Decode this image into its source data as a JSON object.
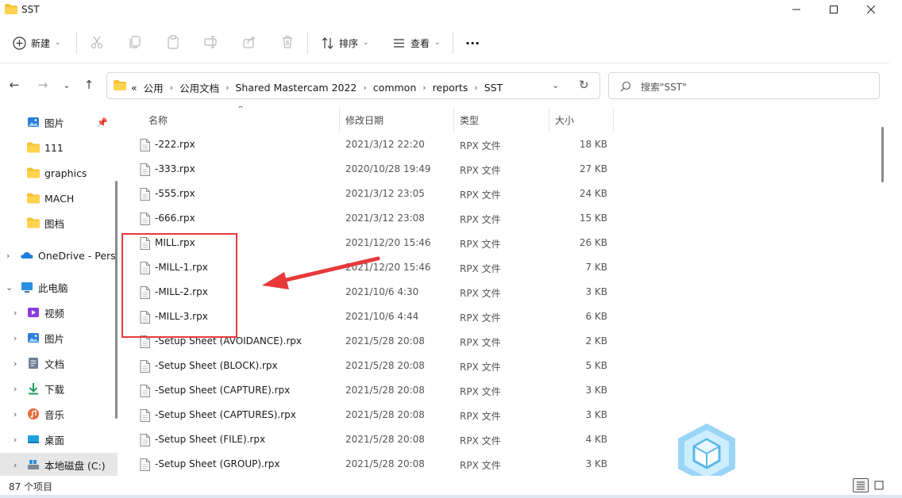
{
  "window": {
    "title": "SST",
    "minimize_icon": "minimize-icon",
    "maximize_icon": "maximize-icon",
    "close_icon": "close-icon"
  },
  "toolbar": {
    "new_label": "新建",
    "sort_label": "排序",
    "view_label": "查看",
    "more_label": "···",
    "icons": [
      "cut-icon",
      "copy-icon",
      "paste-icon",
      "rename-icon",
      "share-icon",
      "delete-icon"
    ]
  },
  "address": {
    "prefix": "«",
    "crumbs": [
      "公用",
      "公用文档",
      "Shared Mastercam 2022",
      "common",
      "reports",
      "SST"
    ]
  },
  "search": {
    "placeholder": "搜索\"SST\""
  },
  "sidebar": {
    "items": [
      {
        "label": "图片",
        "icon": "pictures-icon",
        "pinned": true
      },
      {
        "label": "111",
        "icon": "folder-icon"
      },
      {
        "label": "graphics",
        "icon": "folder-icon"
      },
      {
        "label": "MACH",
        "icon": "folder-icon"
      },
      {
        "label": "图档",
        "icon": "folder-icon"
      },
      {
        "label": "OneDrive - Pers",
        "icon": "onedrive-icon"
      },
      {
        "label": "此电脑",
        "icon": "this-pc-icon"
      },
      {
        "label": "视频",
        "icon": "videos-icon"
      },
      {
        "label": "图片",
        "icon": "pictures-icon"
      },
      {
        "label": "文档",
        "icon": "documents-icon"
      },
      {
        "label": "下载",
        "icon": "downloads-icon"
      },
      {
        "label": "音乐",
        "icon": "music-icon"
      },
      {
        "label": "桌面",
        "icon": "desktop-icon"
      },
      {
        "label": "本地磁盘 (C:)",
        "icon": "drive-icon"
      }
    ]
  },
  "columns": {
    "name": "名称",
    "date": "修改日期",
    "type": "类型",
    "size": "大小"
  },
  "files": [
    {
      "name": "-222.rpx",
      "date": "2021/3/12 22:20",
      "type": "RPX 文件",
      "size": "18 KB"
    },
    {
      "name": "-333.rpx",
      "date": "2020/10/28 19:49",
      "type": "RPX 文件",
      "size": "27 KB"
    },
    {
      "name": "-555.rpx",
      "date": "2021/3/12 23:05",
      "type": "RPX 文件",
      "size": "24 KB"
    },
    {
      "name": "-666.rpx",
      "date": "2021/3/12 23:08",
      "type": "RPX 文件",
      "size": "15 KB"
    },
    {
      "name": "MILL.rpx",
      "date": "2021/12/20 15:46",
      "type": "RPX 文件",
      "size": "26 KB"
    },
    {
      "name": "-MILL-1.rpx",
      "date": "2021/12/20 15:46",
      "type": "RPX 文件",
      "size": "7 KB"
    },
    {
      "name": "-MILL-2.rpx",
      "date": "2021/10/6 4:30",
      "type": "RPX 文件",
      "size": "3 KB"
    },
    {
      "name": "-MILL-3.rpx",
      "date": "2021/10/6 4:44",
      "type": "RPX 文件",
      "size": "6 KB"
    },
    {
      "name": "-Setup Sheet (AVOIDANCE).rpx",
      "date": "2021/5/28 20:08",
      "type": "RPX 文件",
      "size": "2 KB"
    },
    {
      "name": "-Setup Sheet (BLOCK).rpx",
      "date": "2021/5/28 20:08",
      "type": "RPX 文件",
      "size": "5 KB"
    },
    {
      "name": "-Setup Sheet (CAPTURE).rpx",
      "date": "2021/5/28 20:08",
      "type": "RPX 文件",
      "size": "3 KB"
    },
    {
      "name": "-Setup Sheet (CAPTURES).rpx",
      "date": "2021/5/28 20:08",
      "type": "RPX 文件",
      "size": "3 KB"
    },
    {
      "name": "-Setup Sheet (FILE).rpx",
      "date": "2021/5/28 20:08",
      "type": "RPX 文件",
      "size": "4 KB"
    },
    {
      "name": "-Setup Sheet (GROUP).rpx",
      "date": "2021/5/28 20:08",
      "type": "RPX 文件",
      "size": "3 KB"
    }
  ],
  "status": {
    "count_text": "87 个项目"
  },
  "annotation": {
    "color": "#e8393a"
  }
}
